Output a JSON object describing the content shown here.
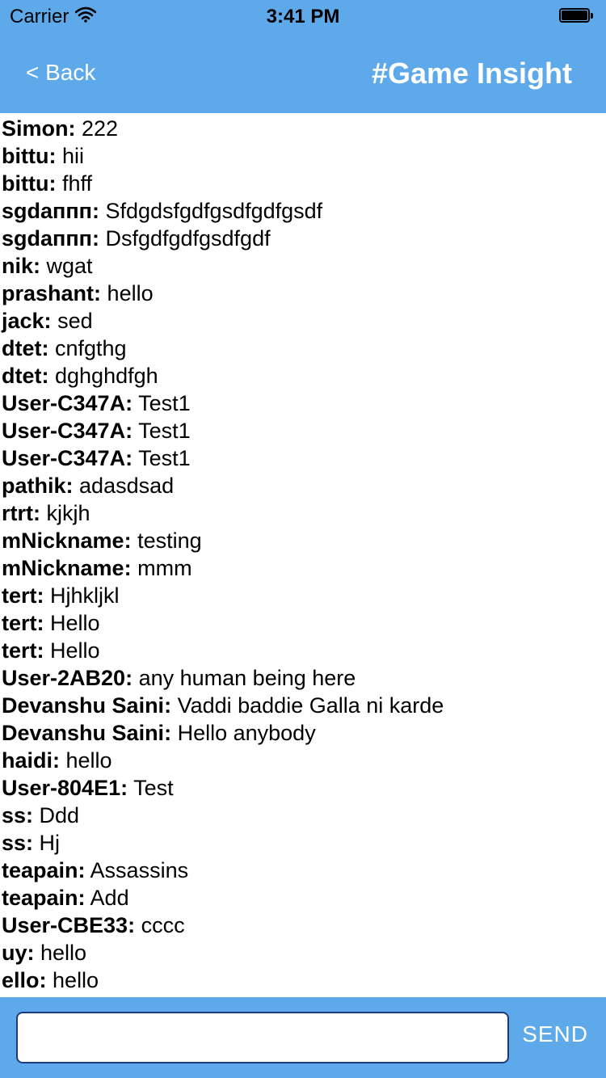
{
  "status_bar": {
    "carrier": "Carrier",
    "time": "3:41 PM"
  },
  "nav": {
    "back_label": "< Back",
    "title": "#Game Insight"
  },
  "messages": [
    {
      "user": "Simon:",
      "text": "222"
    },
    {
      "user": "bittu:",
      "text": "hii"
    },
    {
      "user": "bittu:",
      "text": "fhff"
    },
    {
      "user": "sgdaппп:",
      "text": "Sfdgdsfgdfgsdfgdfgsdf"
    },
    {
      "user": "sgdaппп:",
      "text": "Dsfgdfgdfgsdfgdf"
    },
    {
      "user": "nik:",
      "text": "wgat"
    },
    {
      "user": "prashant:",
      "text": "hello"
    },
    {
      "user": "jack:",
      "text": "sed"
    },
    {
      "user": "dtet:",
      "text": "cnfgthg"
    },
    {
      "user": "dtet:",
      "text": "dghghdfgh"
    },
    {
      "user": "User-C347A:",
      "text": "Test1"
    },
    {
      "user": "User-C347A:",
      "text": "Test1"
    },
    {
      "user": "User-C347A:",
      "text": "Test1"
    },
    {
      "user": "pathik:",
      "text": "adasdsad"
    },
    {
      "user": "rtrt:",
      "text": "kjkjh"
    },
    {
      "user": "mNickname:",
      "text": "testing"
    },
    {
      "user": "mNickname:",
      "text": "mmm"
    },
    {
      "user": "tert:",
      "text": "Hjhkljkl"
    },
    {
      "user": "tert:",
      "text": "Hello"
    },
    {
      "user": "tert:",
      "text": "Hello"
    },
    {
      "user": "User-2AB20:",
      "text": "any human being here"
    },
    {
      "user": "Devanshu Saini:",
      "text": "Vaddi baddie Galla ni karde"
    },
    {
      "user": "Devanshu Saini:",
      "text": "Hello anybody"
    },
    {
      "user": "haidi:",
      "text": "hello"
    },
    {
      "user": "User-804E1:",
      "text": "Test"
    },
    {
      "user": "ss:",
      "text": "Ddd"
    },
    {
      "user": "ss:",
      "text": "Hj"
    },
    {
      "user": "teapain:",
      "text": "Assassins"
    },
    {
      "user": "teapain:",
      "text": "Add"
    },
    {
      "user": "User-CBE33:",
      "text": "cccc"
    },
    {
      "user": "uy:",
      "text": "hello"
    },
    {
      "user": "ello:",
      "text": "hello"
    }
  ],
  "composer": {
    "input_value": "",
    "send_label": "SEND"
  },
  "colors": {
    "header_bg": "#5ea9ea",
    "input_border": "#1f3a7a"
  }
}
